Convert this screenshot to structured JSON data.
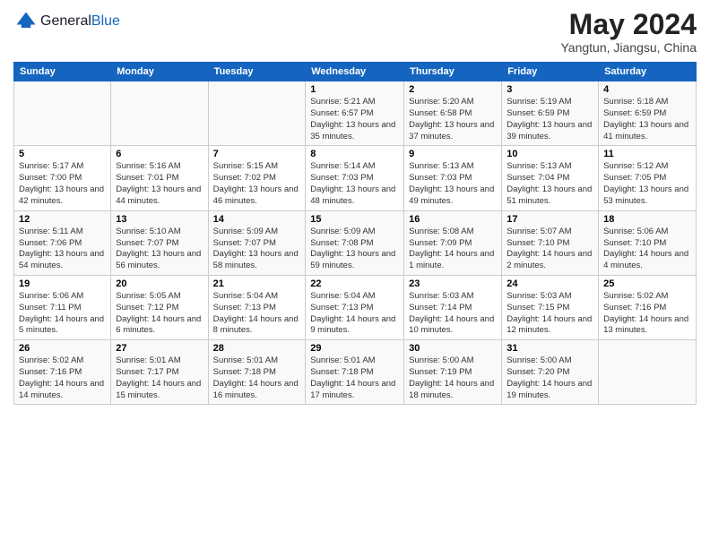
{
  "header": {
    "logo_general": "General",
    "logo_blue": "Blue",
    "month_title": "May 2024",
    "location": "Yangtun, Jiangsu, China"
  },
  "weekdays": [
    "Sunday",
    "Monday",
    "Tuesday",
    "Wednesday",
    "Thursday",
    "Friday",
    "Saturday"
  ],
  "weeks": [
    [
      {
        "day": "",
        "sunrise": "",
        "sunset": "",
        "daylight": ""
      },
      {
        "day": "",
        "sunrise": "",
        "sunset": "",
        "daylight": ""
      },
      {
        "day": "",
        "sunrise": "",
        "sunset": "",
        "daylight": ""
      },
      {
        "day": "1",
        "sunrise": "Sunrise: 5:21 AM",
        "sunset": "Sunset: 6:57 PM",
        "daylight": "Daylight: 13 hours and 35 minutes."
      },
      {
        "day": "2",
        "sunrise": "Sunrise: 5:20 AM",
        "sunset": "Sunset: 6:58 PM",
        "daylight": "Daylight: 13 hours and 37 minutes."
      },
      {
        "day": "3",
        "sunrise": "Sunrise: 5:19 AM",
        "sunset": "Sunset: 6:59 PM",
        "daylight": "Daylight: 13 hours and 39 minutes."
      },
      {
        "day": "4",
        "sunrise": "Sunrise: 5:18 AM",
        "sunset": "Sunset: 6:59 PM",
        "daylight": "Daylight: 13 hours and 41 minutes."
      }
    ],
    [
      {
        "day": "5",
        "sunrise": "Sunrise: 5:17 AM",
        "sunset": "Sunset: 7:00 PM",
        "daylight": "Daylight: 13 hours and 42 minutes."
      },
      {
        "day": "6",
        "sunrise": "Sunrise: 5:16 AM",
        "sunset": "Sunset: 7:01 PM",
        "daylight": "Daylight: 13 hours and 44 minutes."
      },
      {
        "day": "7",
        "sunrise": "Sunrise: 5:15 AM",
        "sunset": "Sunset: 7:02 PM",
        "daylight": "Daylight: 13 hours and 46 minutes."
      },
      {
        "day": "8",
        "sunrise": "Sunrise: 5:14 AM",
        "sunset": "Sunset: 7:03 PM",
        "daylight": "Daylight: 13 hours and 48 minutes."
      },
      {
        "day": "9",
        "sunrise": "Sunrise: 5:13 AM",
        "sunset": "Sunset: 7:03 PM",
        "daylight": "Daylight: 13 hours and 49 minutes."
      },
      {
        "day": "10",
        "sunrise": "Sunrise: 5:13 AM",
        "sunset": "Sunset: 7:04 PM",
        "daylight": "Daylight: 13 hours and 51 minutes."
      },
      {
        "day": "11",
        "sunrise": "Sunrise: 5:12 AM",
        "sunset": "Sunset: 7:05 PM",
        "daylight": "Daylight: 13 hours and 53 minutes."
      }
    ],
    [
      {
        "day": "12",
        "sunrise": "Sunrise: 5:11 AM",
        "sunset": "Sunset: 7:06 PM",
        "daylight": "Daylight: 13 hours and 54 minutes."
      },
      {
        "day": "13",
        "sunrise": "Sunrise: 5:10 AM",
        "sunset": "Sunset: 7:07 PM",
        "daylight": "Daylight: 13 hours and 56 minutes."
      },
      {
        "day": "14",
        "sunrise": "Sunrise: 5:09 AM",
        "sunset": "Sunset: 7:07 PM",
        "daylight": "Daylight: 13 hours and 58 minutes."
      },
      {
        "day": "15",
        "sunrise": "Sunrise: 5:09 AM",
        "sunset": "Sunset: 7:08 PM",
        "daylight": "Daylight: 13 hours and 59 minutes."
      },
      {
        "day": "16",
        "sunrise": "Sunrise: 5:08 AM",
        "sunset": "Sunset: 7:09 PM",
        "daylight": "Daylight: 14 hours and 1 minute."
      },
      {
        "day": "17",
        "sunrise": "Sunrise: 5:07 AM",
        "sunset": "Sunset: 7:10 PM",
        "daylight": "Daylight: 14 hours and 2 minutes."
      },
      {
        "day": "18",
        "sunrise": "Sunrise: 5:06 AM",
        "sunset": "Sunset: 7:10 PM",
        "daylight": "Daylight: 14 hours and 4 minutes."
      }
    ],
    [
      {
        "day": "19",
        "sunrise": "Sunrise: 5:06 AM",
        "sunset": "Sunset: 7:11 PM",
        "daylight": "Daylight: 14 hours and 5 minutes."
      },
      {
        "day": "20",
        "sunrise": "Sunrise: 5:05 AM",
        "sunset": "Sunset: 7:12 PM",
        "daylight": "Daylight: 14 hours and 6 minutes."
      },
      {
        "day": "21",
        "sunrise": "Sunrise: 5:04 AM",
        "sunset": "Sunset: 7:13 PM",
        "daylight": "Daylight: 14 hours and 8 minutes."
      },
      {
        "day": "22",
        "sunrise": "Sunrise: 5:04 AM",
        "sunset": "Sunset: 7:13 PM",
        "daylight": "Daylight: 14 hours and 9 minutes."
      },
      {
        "day": "23",
        "sunrise": "Sunrise: 5:03 AM",
        "sunset": "Sunset: 7:14 PM",
        "daylight": "Daylight: 14 hours and 10 minutes."
      },
      {
        "day": "24",
        "sunrise": "Sunrise: 5:03 AM",
        "sunset": "Sunset: 7:15 PM",
        "daylight": "Daylight: 14 hours and 12 minutes."
      },
      {
        "day": "25",
        "sunrise": "Sunrise: 5:02 AM",
        "sunset": "Sunset: 7:16 PM",
        "daylight": "Daylight: 14 hours and 13 minutes."
      }
    ],
    [
      {
        "day": "26",
        "sunrise": "Sunrise: 5:02 AM",
        "sunset": "Sunset: 7:16 PM",
        "daylight": "Daylight: 14 hours and 14 minutes."
      },
      {
        "day": "27",
        "sunrise": "Sunrise: 5:01 AM",
        "sunset": "Sunset: 7:17 PM",
        "daylight": "Daylight: 14 hours and 15 minutes."
      },
      {
        "day": "28",
        "sunrise": "Sunrise: 5:01 AM",
        "sunset": "Sunset: 7:18 PM",
        "daylight": "Daylight: 14 hours and 16 minutes."
      },
      {
        "day": "29",
        "sunrise": "Sunrise: 5:01 AM",
        "sunset": "Sunset: 7:18 PM",
        "daylight": "Daylight: 14 hours and 17 minutes."
      },
      {
        "day": "30",
        "sunrise": "Sunrise: 5:00 AM",
        "sunset": "Sunset: 7:19 PM",
        "daylight": "Daylight: 14 hours and 18 minutes."
      },
      {
        "day": "31",
        "sunrise": "Sunrise: 5:00 AM",
        "sunset": "Sunset: 7:20 PM",
        "daylight": "Daylight: 14 hours and 19 minutes."
      },
      {
        "day": "",
        "sunrise": "",
        "sunset": "",
        "daylight": ""
      }
    ]
  ]
}
